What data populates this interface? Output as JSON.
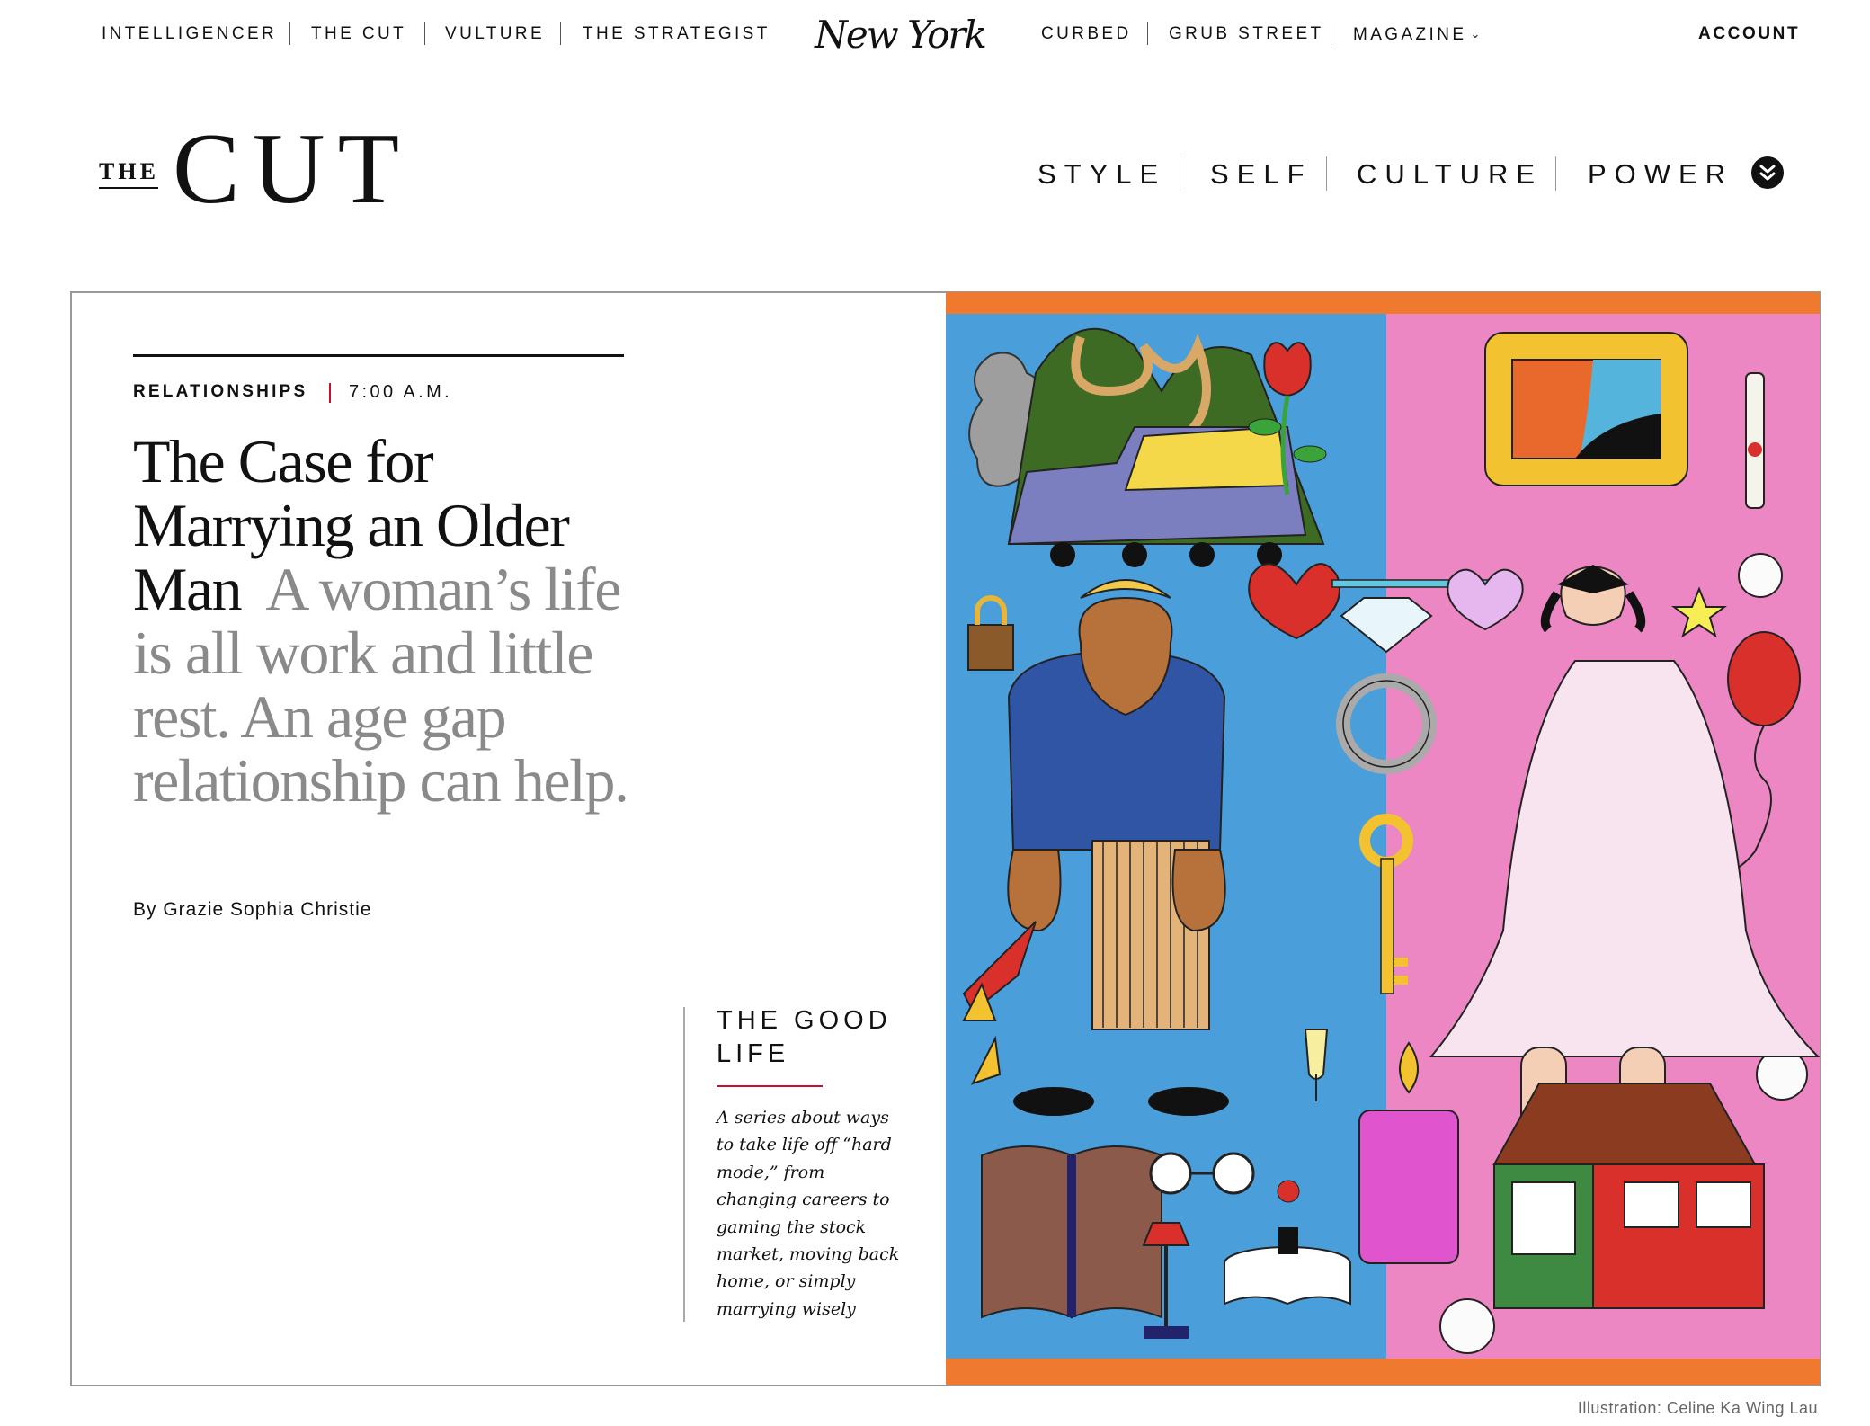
{
  "topnav": {
    "items": [
      "INTELLIGENCER",
      "THE CUT",
      "VULTURE",
      "THE STRATEGIST",
      "CURBED",
      "GRUB STREET",
      "MAGAZINE"
    ],
    "logo": "New York",
    "account": "ACCOUNT"
  },
  "brand": {
    "the": "THE",
    "cut": "CUT"
  },
  "sections": [
    "STYLE",
    "SELF",
    "CULTURE",
    "POWER"
  ],
  "article": {
    "rubric": "RELATIONSHIPS",
    "time": "7:00 A.M.",
    "headline": "The Case for Marrying an Older Man",
    "dek": "A woman’s life is all work and little rest. An age gap relationship can help.",
    "byline": "By Grazie Sophia Christie"
  },
  "series": {
    "title": "THE GOOD LIFE",
    "description": "A series about ways to take life off “hard mode,” from changing careers to gaming the stock market, moving back home, or simply marrying wisely"
  },
  "illustration_credit": "Illustration: Celine Ka Wing Lau",
  "colors": {
    "accent_red": "#c8102e",
    "illus_blue": "#4a9ed9",
    "illus_pink": "#ec87c3",
    "illus_orange": "#ef7a2f"
  },
  "icons": [
    "chevron-down-icon",
    "double-chevron-down-icon"
  ]
}
